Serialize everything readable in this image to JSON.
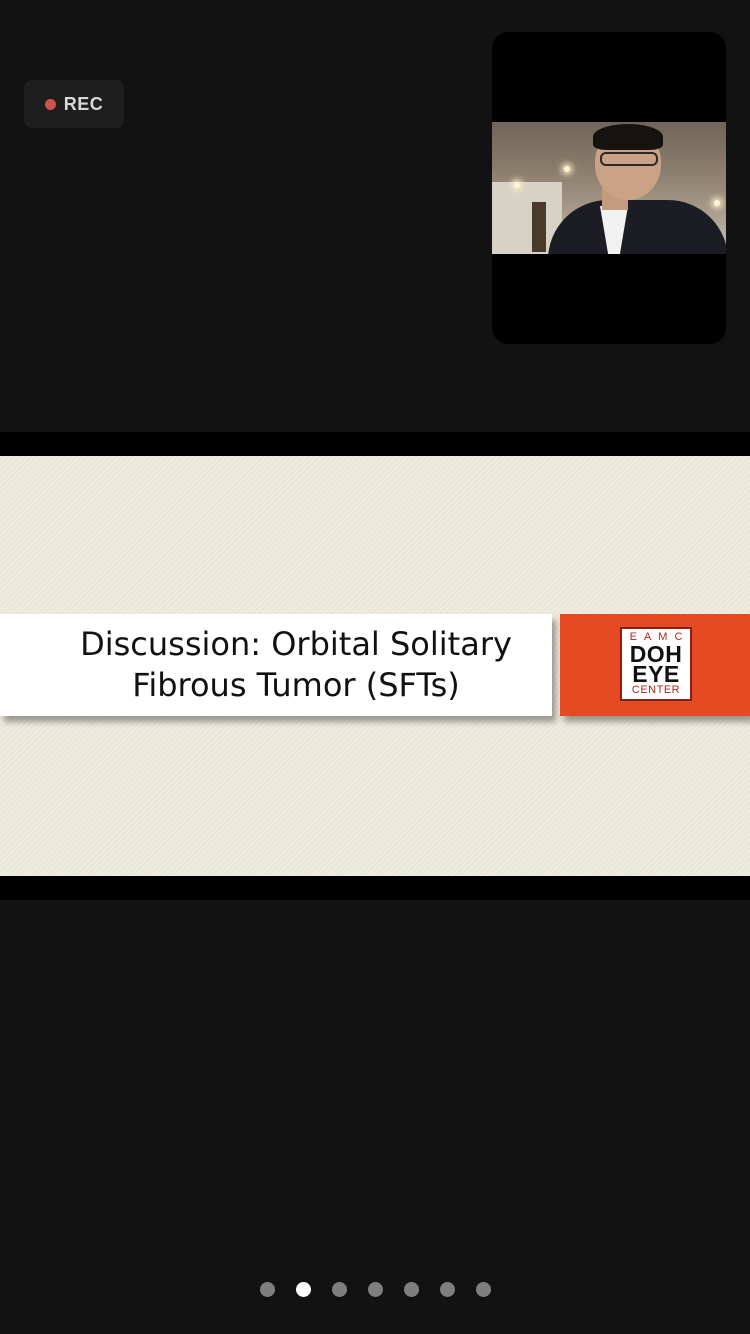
{
  "recording": {
    "label": "REC",
    "dot_color": "#d0524c"
  },
  "self_video": {
    "icon": "participant-video"
  },
  "shared_slide": {
    "title_line_1": "Discussion: Orbital Solitary",
    "title_line_2": "Fibrous Tumor (SFTs)",
    "logo": {
      "top": "EAMC",
      "middle_1": "DOH",
      "middle_2": "EYE",
      "bottom": "CENTER"
    },
    "accent_color": "#e44b23"
  },
  "pagination": {
    "total": 7,
    "active_index": 1
  }
}
